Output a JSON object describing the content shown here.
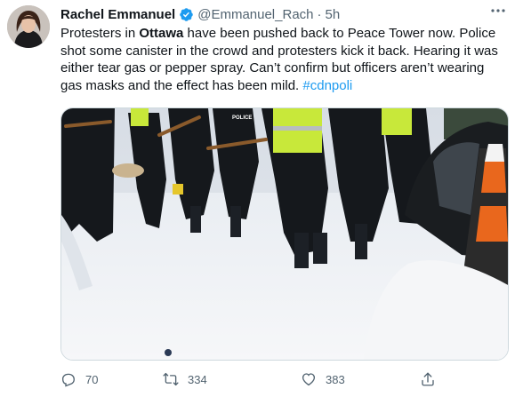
{
  "tweet": {
    "author_name": "Rachel Emmanuel",
    "handle": "@Emmanuel_Rach",
    "separator": "·",
    "timestamp": "5h",
    "text_before_bold": "Protesters in ",
    "text_bold": "Ottawa",
    "text_after_bold": " have been pushed back to Peace Tower now. Police shot some canister in the crowd and protesters kick it back. Hearing it was either tear gas or pepper spray. Can’t confirm but officers aren’t wearing gas masks and the effect has been mild. ",
    "hashtag": "#cdnpoli",
    "media_badge": "POLICE"
  },
  "actions": {
    "reply_count": "70",
    "retweet_count": "334",
    "like_count": "383"
  },
  "colors": {
    "text": "#0f1419",
    "secondary": "#536471",
    "accent": "#1d9bf0",
    "vest": "#c8e83a",
    "cone_orange": "#e9671d"
  },
  "icons": {
    "verified": "verified-badge-icon",
    "more": "more-dots-icon",
    "reply": "reply-icon",
    "retweet": "retweet-icon",
    "like": "heart-icon",
    "share": "share-icon"
  }
}
